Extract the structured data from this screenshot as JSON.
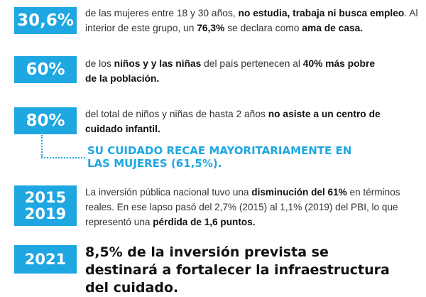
{
  "items": [
    {
      "badge": "30,6%",
      "parts": [
        {
          "t": "de las mujeres entre 18 y 30 años, ",
          "b": false
        },
        {
          "t": "no estudia, trabaja ni busca empleo",
          "b": true
        },
        {
          "t": ". Al interior de este grupo, un ",
          "b": false
        },
        {
          "t": "76,3%",
          "b": true
        },
        {
          "t": " se declara como ",
          "b": false
        },
        {
          "t": "ama de casa.",
          "b": true
        }
      ]
    },
    {
      "badge": "60%",
      "parts": [
        {
          "t": "de los ",
          "b": false
        },
        {
          "t": "niños y y las niñas",
          "b": true
        },
        {
          "t": " del país pertenecen al ",
          "b": false
        },
        {
          "t": "40% más pobre de la población.",
          "b": true
        }
      ]
    },
    {
      "badge": "80%",
      "parts": [
        {
          "t": "del total de niños y niñas de hasta 2 años ",
          "b": false
        },
        {
          "t": "no asiste a un centro de cuidado infantil.",
          "b": true
        }
      ]
    },
    {
      "badge_line1": "2015",
      "badge_line2": "2019",
      "parts": [
        {
          "t": "La inversión pública nacional tuvo una ",
          "b": false
        },
        {
          "t": "disminución del 61%",
          "b": true
        },
        {
          "t": " en términos reales. En ese lapso pasó del 2,7% (2015) al 1,1% (2019) del PBI,  lo que representó una ",
          "b": false
        },
        {
          "t": "pérdida de 1,6 puntos.",
          "b": true
        }
      ]
    },
    {
      "badge": "2021",
      "text": "8,5% de la inversión prevista se destinará a fortalecer la infraestructura del cuidado."
    }
  ],
  "highlight": "SU CUIDADO RECAE MAYORITARIAMENTE EN LAS MUJERES (61,5%).",
  "colors": {
    "accent": "#1ea7e1",
    "badge_text": "#ffffff",
    "text": "#333333"
  }
}
